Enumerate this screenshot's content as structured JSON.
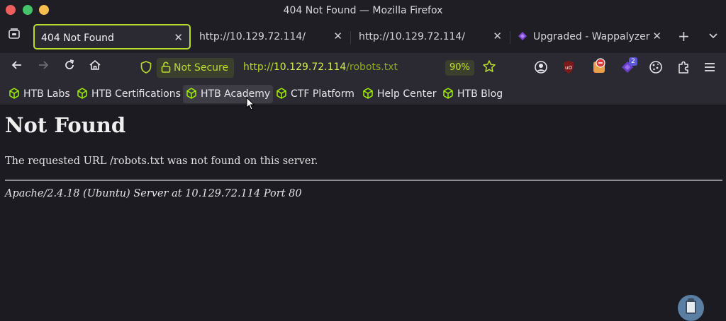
{
  "window": {
    "title": "404 Not Found — Mozilla Firefox"
  },
  "tabs": [
    {
      "label": "404 Not Found",
      "active": true
    },
    {
      "label": "http://10.129.72.114/",
      "active": false
    },
    {
      "label": "http://10.129.72.114/",
      "active": false
    },
    {
      "label": "Upgraded - Wappalyzer",
      "active": false
    }
  ],
  "tabbar": {
    "close_glyph": "✕",
    "new_tab_glyph": "+",
    "list_glyph": "⌄"
  },
  "toolbar": {
    "security_label": "Not Secure",
    "url_scheme": "http://",
    "url_host": "10.129.72.114",
    "url_path": "/robots.txt",
    "zoom": "90%",
    "extension_badge": "2"
  },
  "bookmarks": [
    {
      "label": "HTB Labs"
    },
    {
      "label": "HTB Certifications"
    },
    {
      "label": "HTB Academy"
    },
    {
      "label": "CTF Platform"
    },
    {
      "label": "Help Center"
    },
    {
      "label": "HTB Blog"
    }
  ],
  "page": {
    "heading": "Not Found",
    "message": "The requested URL /robots.txt was not found on this server.",
    "address": "Apache/2.4.18 (Ubuntu) Server at 10.129.72.114 Port 80"
  },
  "colors": {
    "accent": "#b9dc2f",
    "toolbar_bg": "#2b2a33",
    "page_bg": "#1c1b22"
  },
  "icons": {
    "tab_overview": "tab-overview-icon",
    "back": "back-arrow-icon",
    "forward": "forward-arrow-icon",
    "reload": "reload-icon",
    "home": "home-icon",
    "shield": "tracking-shield-icon",
    "lock": "unlocked-padlock-icon",
    "bookmark_star": "star-icon",
    "account": "account-icon",
    "ublock": "ublock-origin-icon",
    "extension_alert": "extension-alert-icon",
    "wappalyzer": "wappalyzer-icon",
    "cookie": "cookie-icon",
    "extensions": "puzzle-extensions-icon",
    "menu": "hamburger-menu-icon",
    "bookmark": "htb-cube-icon",
    "clipboard": "clipboard-icon"
  }
}
